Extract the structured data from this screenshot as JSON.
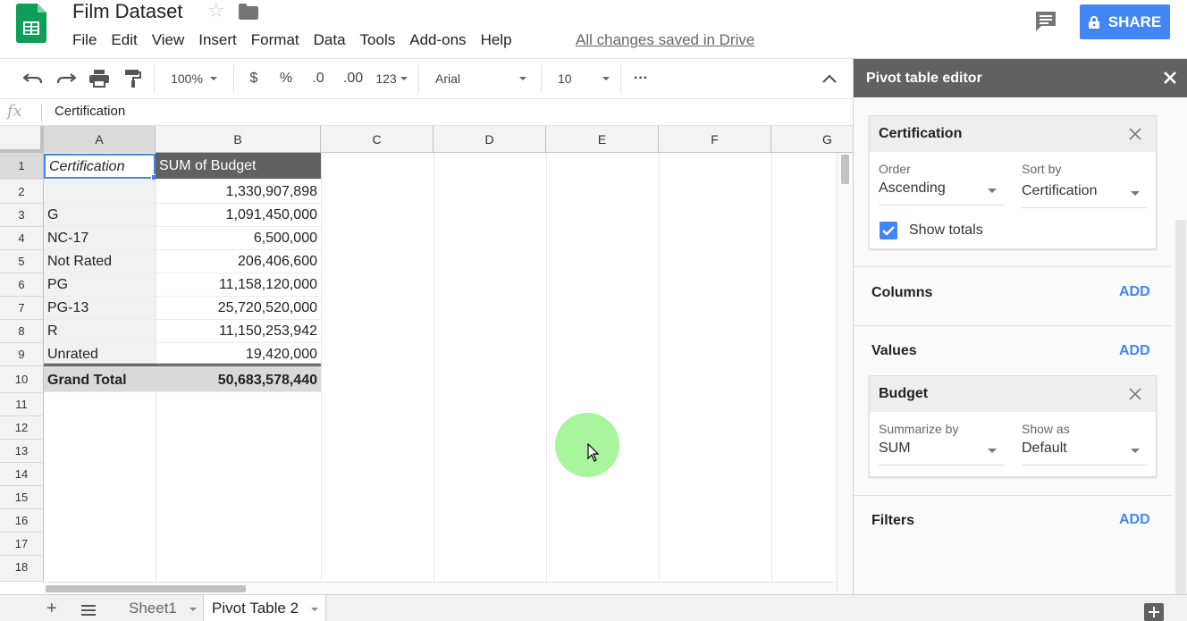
{
  "header": {
    "title": "Film Dataset",
    "menu": [
      "File",
      "Edit",
      "View",
      "Insert",
      "Format",
      "Data",
      "Tools",
      "Add-ons",
      "Help"
    ],
    "saved_status": "All changes saved in Drive",
    "share_label": "SHARE",
    "accent_color": "#4285f4"
  },
  "toolbar": {
    "zoom": "100%",
    "currency": "$",
    "percent": "%",
    "decrease_decimal": ".0",
    "increase_decimal": ".00",
    "more_formats": "123",
    "font": "Arial",
    "font_size": "10",
    "more": "···",
    "icons": [
      "undo-icon",
      "redo-icon",
      "print-icon",
      "paint-format-icon",
      "collapse-icon"
    ]
  },
  "formula_bar": {
    "fx_label": "fx",
    "value": "Certification"
  },
  "grid": {
    "columns": [
      "A",
      "B",
      "C",
      "D",
      "E",
      "F",
      "G"
    ],
    "rows": [
      "1",
      "2",
      "3",
      "4",
      "5",
      "6",
      "7",
      "8",
      "9",
      "10",
      "11",
      "12",
      "13",
      "14",
      "15",
      "16",
      "17",
      "18"
    ],
    "header_a": "Certification",
    "header_b": "SUM of Budget",
    "data": [
      {
        "a": "",
        "b": "1,330,907,898"
      },
      {
        "a": "G",
        "b": "1,091,450,000"
      },
      {
        "a": "NC-17",
        "b": "6,500,000"
      },
      {
        "a": "Not Rated",
        "b": "206,406,600"
      },
      {
        "a": "PG",
        "b": "11,158,120,000"
      },
      {
        "a": "PG-13",
        "b": "25,720,520,000"
      },
      {
        "a": "R",
        "b": "11,150,253,942"
      },
      {
        "a": "Unrated",
        "b": "19,420,000"
      }
    ],
    "total_label": "Grand Total",
    "total_value": "50,683,578,440"
  },
  "tabs": {
    "sheets": [
      "Sheet1",
      "Pivot Table 2"
    ],
    "active": "Pivot Table 2"
  },
  "pivot_editor": {
    "title": "Pivot table editor",
    "rows_card": {
      "title": "Certification",
      "order_label": "Order",
      "order_value": "Ascending",
      "sort_label": "Sort by",
      "sort_value": "Certification",
      "show_totals_label": "Show totals",
      "show_totals": true
    },
    "columns_label": "Columns",
    "values_label": "Values",
    "filters_label": "Filters",
    "add_label": "ADD",
    "values_card": {
      "title": "Budget",
      "summarize_label": "Summarize by",
      "summarize_value": "SUM",
      "show_as_label": "Show as",
      "show_as_value": "Default"
    }
  }
}
